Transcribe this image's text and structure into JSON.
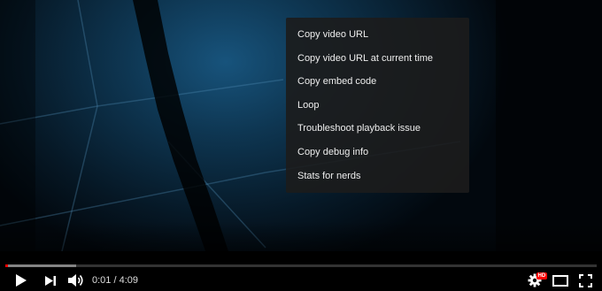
{
  "context_menu": {
    "items": [
      "Copy video URL",
      "Copy video URL at current time",
      "Copy embed code",
      "Loop",
      "Troubleshoot playback issue",
      "Copy debug info",
      "Stats for nerds"
    ]
  },
  "controls": {
    "current_time": "0:01",
    "separator": " / ",
    "duration": "4:09",
    "quality_badge": "HD",
    "progress_played_fraction": 0.004,
    "progress_buffered_fraction": 0.12
  },
  "icons": [
    "play-icon",
    "next-icon",
    "volume-icon",
    "settings-icon",
    "theater-mode-icon",
    "fullscreen-icon"
  ],
  "colors": {
    "progress": "#ff0000",
    "menu_bg": "#1c1c1c",
    "menu_text": "#eeeeee"
  }
}
